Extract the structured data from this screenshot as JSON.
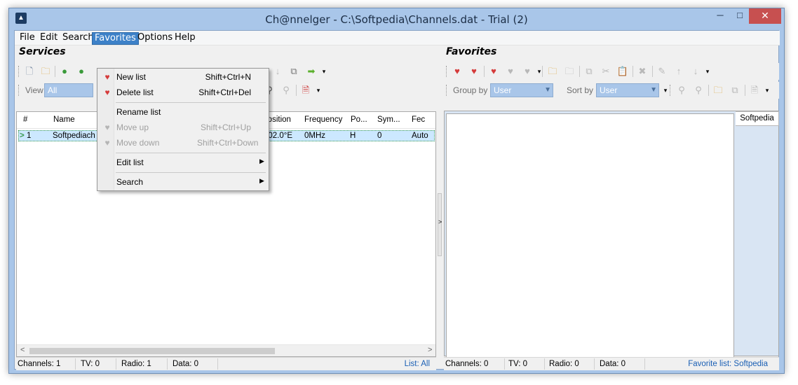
{
  "window": {
    "title": "Ch@nnelger - C:\\Softpedia\\Channels.dat - Trial (2)",
    "buttons": {
      "minimize": "─",
      "maximize": "□",
      "close": "✕"
    }
  },
  "menubar": {
    "items": [
      {
        "label": "File"
      },
      {
        "label": "Edit"
      },
      {
        "label": "Search"
      },
      {
        "label": "Favorites"
      },
      {
        "label": "Options"
      },
      {
        "label": "Help"
      }
    ],
    "active": "Favorites"
  },
  "favorites_menu": {
    "items": [
      {
        "label": "New list",
        "shortcut": "Shift+Ctrl+N",
        "icon": "heart-add-icon",
        "enabled": true
      },
      {
        "label": "Delete list",
        "shortcut": "Shift+Ctrl+Del",
        "icon": "heart-delete-icon",
        "enabled": true
      },
      {
        "label": "Rename list",
        "shortcut": "",
        "enabled": true
      },
      {
        "label": "Move up",
        "shortcut": "Shift+Ctrl+Up",
        "icon": "heart-up-icon",
        "enabled": false
      },
      {
        "label": "Move down",
        "shortcut": "Shift+Ctrl+Down",
        "icon": "heart-down-icon",
        "enabled": false
      },
      {
        "label": "Edit list",
        "submenu": true,
        "enabled": true
      },
      {
        "label": "Search",
        "submenu": true,
        "enabled": true
      }
    ],
    "submenu_arrow": "▶"
  },
  "services": {
    "title": "Services",
    "view_label": "View",
    "view_value": "All",
    "columns": [
      "#",
      "Name",
      "Position",
      "Frequency",
      "Po...",
      "Sym...",
      "Fec"
    ],
    "rows": [
      {
        "num": "1",
        "name": "Softpediach",
        "position": "002.0°E",
        "frequency": "0MHz",
        "po": "H",
        "sym": "0",
        "fec": "Auto"
      }
    ],
    "row_marker": ">",
    "status": {
      "channels": "Channels: 1",
      "tv": "TV: 0",
      "radio": "Radio: 1",
      "data": "Data: 0",
      "list": "List: All"
    }
  },
  "favorites": {
    "title": "Favorites",
    "group_by_label": "Group by",
    "group_by_value": "User",
    "sort_by_label": "Sort by",
    "sort_by_value": "User",
    "tabs": [
      "Softpedia"
    ],
    "status": {
      "channels": "Channels: 0",
      "tv": "TV: 0",
      "radio": "Radio: 0",
      "data": "Data: 0",
      "list": "Favorite list: Softpedia"
    }
  },
  "scroll": {
    "left": "<",
    "right": ">"
  },
  "splitter_arrow": ">",
  "colors": {
    "title_bar": "#a9c6e9",
    "menu_active": "#3d81c8",
    "selection": "#cce8ff",
    "close_button": "#c75050",
    "link": "#1a5fb4"
  }
}
